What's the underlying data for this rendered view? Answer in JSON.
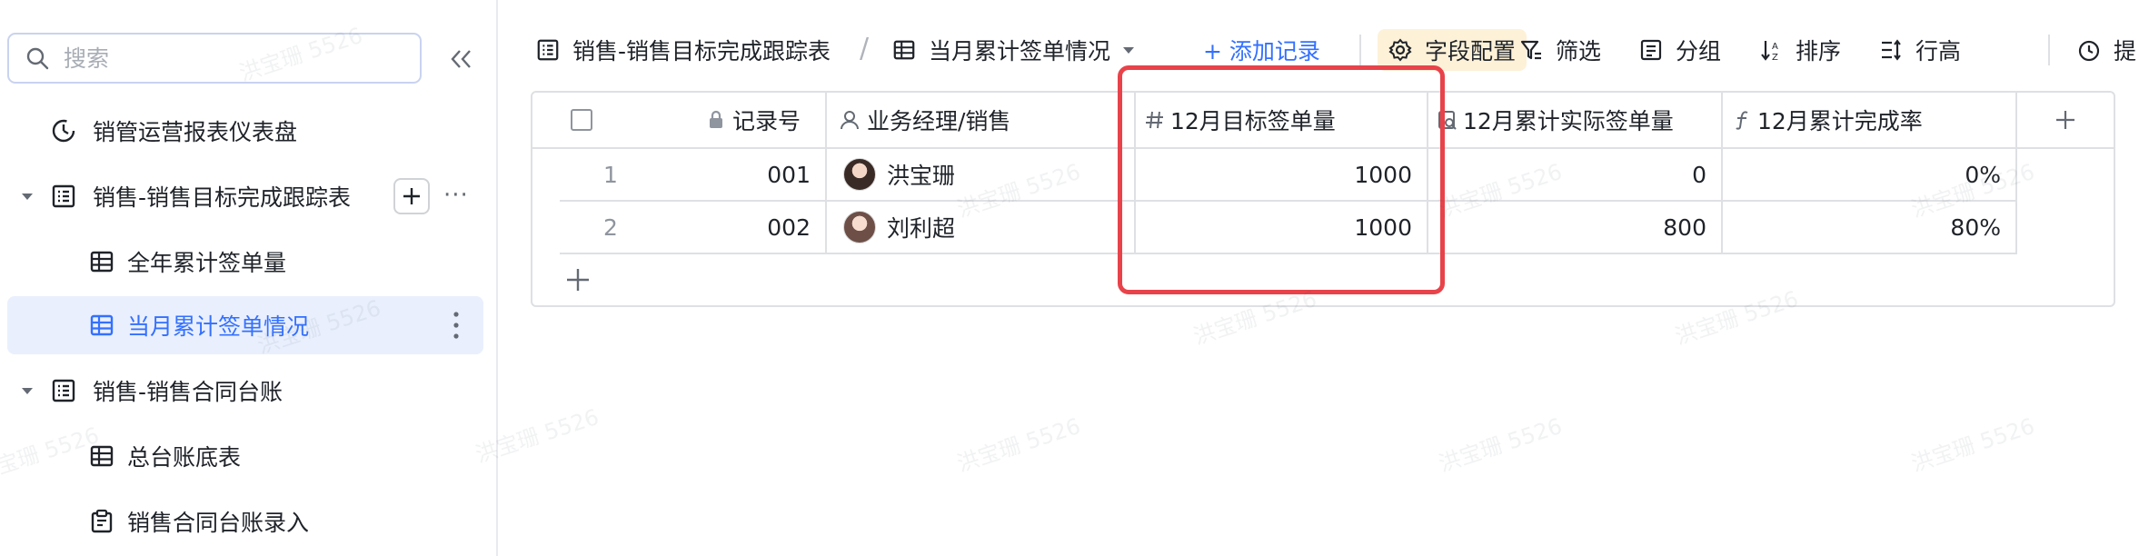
{
  "sidebar": {
    "search_placeholder": "搜索",
    "items": [
      {
        "label": "销管运营报表仪表盘"
      },
      {
        "label": "销售-销售目标完成跟踪表"
      },
      {
        "label": "全年累计签单量"
      },
      {
        "label": "当月累计签单情况"
      },
      {
        "label": "销售-销售合同台账"
      },
      {
        "label": "总台账底表"
      },
      {
        "label": "销售合同台账录入"
      }
    ]
  },
  "toolbar": {
    "table_name": "销售-销售目标完成跟踪表",
    "separator": "/",
    "view_name": "当月累计签单情况",
    "add_record": "+ 添加记录",
    "field_config": "字段配置",
    "filter": "筛选",
    "group": "分组",
    "sort": "排序",
    "row_height": "行高",
    "more": "提"
  },
  "grid": {
    "columns": [
      "记录号",
      "业务经理/销售",
      "12月目标签单量",
      "12月累计实际签单量",
      "12月累计完成率"
    ],
    "rows": [
      {
        "index": "1",
        "record": "001",
        "manager": "洪宝珊",
        "target": "1000",
        "actual": "0",
        "rate": "0%"
      },
      {
        "index": "2",
        "record": "002",
        "manager": "刘利超",
        "target": "1000",
        "actual": "800",
        "rate": "80%"
      }
    ]
  },
  "watermark": "洪宝珊 5526",
  "colors": {
    "accent": "#3370ff",
    "highlight_box": "#e8434a",
    "field_config_bg": "#fdf1d8"
  }
}
